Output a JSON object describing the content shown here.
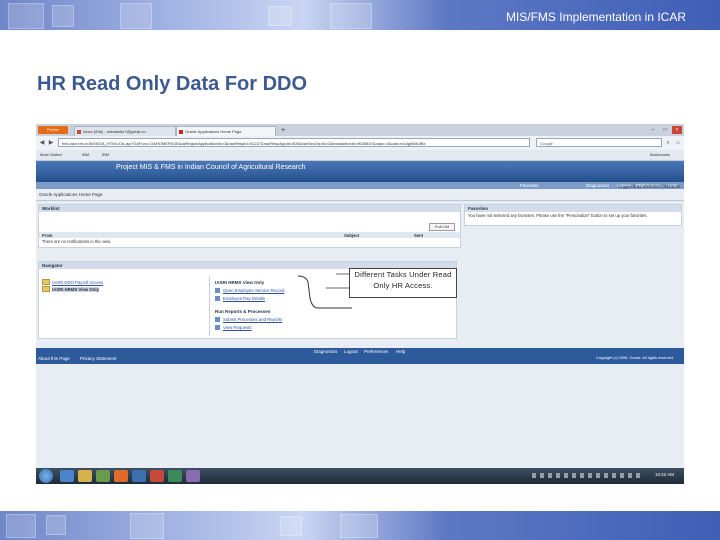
{
  "slide": {
    "header_text": "MIS/FMS Implementation in ICAR",
    "title": "HR Read Only Data For DDO"
  },
  "browser": {
    "ff_button": "Firefox",
    "tabs": [
      {
        "label": "Inbox (846) - mitrabelto7@gmail.co...",
        "active": false
      },
      {
        "label": "Oracle Applications Home Page",
        "active": true
      }
    ],
    "url": "fms.iasri.res.in:8005/OA_HTML/OA.jsp?OAFunc=OAHOMEPAGE&akRegionApplicationId=0&navRespId=51227&navRespAppId=800&navSecGrpId=0&transactionid=9635847&oapc=4&oas=m1dgM6rUlBx",
    "search_placeholder": "Google",
    "bookmarks": [
      "Most Visited",
      "IBM",
      "IBM"
    ],
    "bookmarks_menu": "Bookmarks"
  },
  "oracle": {
    "banner_title": "Project MIS & FMS in Indian Council of Agricultural Research",
    "top_links": [
      "Favorites",
      "Diagnostics",
      "Logout",
      "Preferences",
      "Help"
    ],
    "logged_in": "Logged In As SRSHEEL_SARKAR",
    "page_title": "Oracle Applications Home Page",
    "worklist": {
      "heading": "Worklist",
      "full_list_button": "Full List",
      "columns": [
        "From",
        "Subject",
        "Sent"
      ],
      "empty_message": "There are no notifications in the view."
    },
    "favorites": {
      "heading": "Favorites",
      "message": "You have not selected any favorites. Please use the \"Personalize\" button to set up your favorites."
    },
    "navigator": {
      "heading": "Navigator",
      "responsibilities": [
        {
          "label": "IASRI DDO Payroll Access",
          "selected": false
        },
        {
          "label": "IASRI HRMS View Only",
          "selected": true
        }
      ],
      "group_title": "IASRI HRMS View Only",
      "functions": [
        "Open Employee Service Record",
        "Employee Pay Details"
      ],
      "reports_heading": "Run Reports & Processes",
      "reports": [
        "Submit Processes and Reports",
        "View Requests"
      ]
    },
    "footer_links": [
      "Diagnostics",
      "Logout",
      "Preferences",
      "Help"
    ],
    "bottom_links": [
      "About this Page",
      "Privacy Statement"
    ],
    "copyright": "Copyright (c) 2006, Oracle. All rights reserved."
  },
  "callout": {
    "text": "Different Tasks Under Read Only HR Access."
  },
  "taskbar": {
    "clock": "10:22 AM"
  }
}
